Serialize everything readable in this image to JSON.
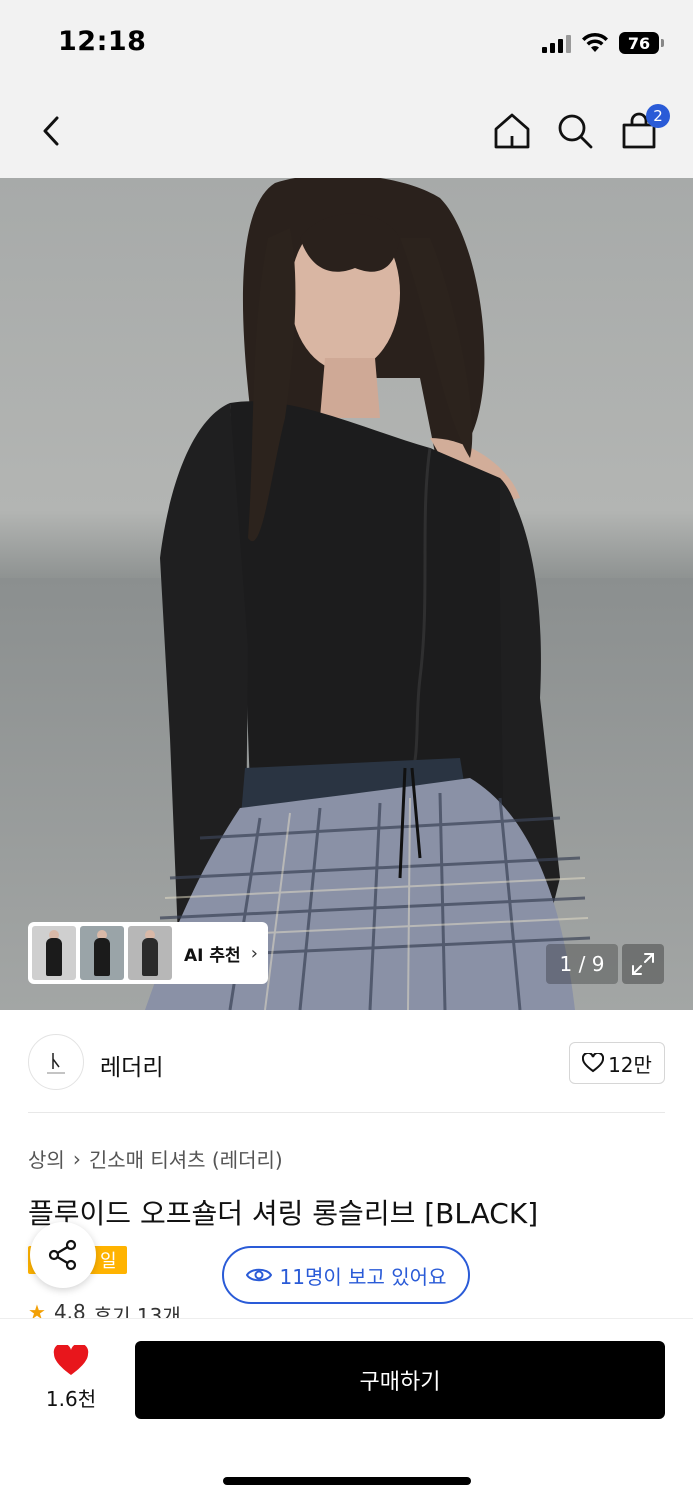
{
  "status_bar": {
    "time": "12:18",
    "battery": "76"
  },
  "nav": {
    "back_icon": "chevron-left-icon",
    "home_icon": "home-icon",
    "search_icon": "search-icon",
    "cart_icon": "shopping-bag-icon",
    "cart_count": "2"
  },
  "hero": {
    "recommend_label": "AI 추천",
    "page_counter": "1 / 9",
    "expand_icon": "expand-icon"
  },
  "brand": {
    "name": "레더리",
    "likes": "12만"
  },
  "product": {
    "breadcrumb": [
      "상의",
      "긴소매 티셔츠 (레더리)"
    ],
    "title": "플루이드 오프숄더 셔링 롱슬리브 [BLACK]",
    "tag": "일",
    "viewers": "11명이 보고 있어요",
    "rating": "4.8",
    "reviews": "후기 13개"
  },
  "bottom": {
    "wish_count": "1.6천",
    "buy_label": "구매하기"
  },
  "colors": {
    "accent": "#2a5bd7",
    "buy": "#000000",
    "heart": "#e8161c",
    "tag": "#ffb300"
  }
}
